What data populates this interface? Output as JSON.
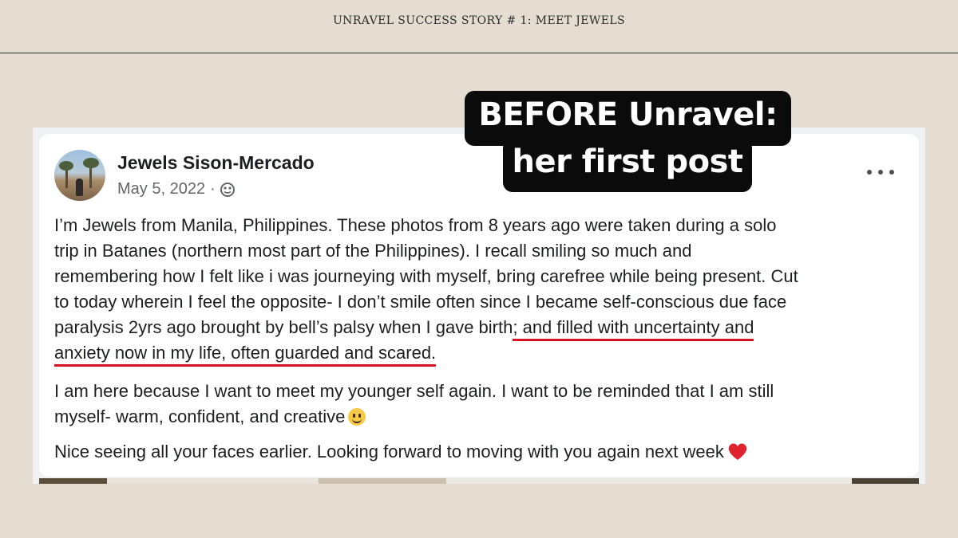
{
  "header": {
    "title": "UNRAVEL SUCCESS STORY # 1: MEET JEWELS"
  },
  "callout": {
    "line1": "BEFORE Unravel:",
    "line2": "her first post"
  },
  "post": {
    "author": "Jewels Sison-Mercado",
    "date": "May 5, 2022",
    "separator": "·",
    "audience_icon": "globe-icon",
    "more_icon": "more-options-icon",
    "paragraph1": [
      "I’m Jewels from Manila, Philippines. These photos from 8 years ago were taken during a solo",
      "trip in Batanes (northern most part of the Philippines). I recall smiling so much and",
      "remembering how I felt like i was journeying with myself, bring carefree while being present. Cut",
      "to today wherein I feel the opposite- I don’t smile often since I became self-conscious due face"
    ],
    "paragraph1_line5_plain": "paralysis 2yrs ago brought by bell’s palsy when I gave birth",
    "paragraph1_line5_underlined": "; and filled with uncertainty and",
    "paragraph1_line6_underlined": "anxiety now in my life, often guarded and scared.",
    "paragraph2": [
      "I am here because I want to meet my younger self again. I want to be reminded that I am still",
      "myself- warm, confident, and creative"
    ],
    "paragraph2_emoji": "smiling-face-emoji",
    "paragraph3": "Nice seeing all your faces earlier. Looking forward to moving with you again next week",
    "paragraph3_emoji": "red-heart-emoji"
  },
  "colors": {
    "background": "#e6ddd2",
    "underline": "#d7121f",
    "callout_bg": "#0b0b0b",
    "text": "#1c1e21",
    "meta_text": "#65676b"
  }
}
